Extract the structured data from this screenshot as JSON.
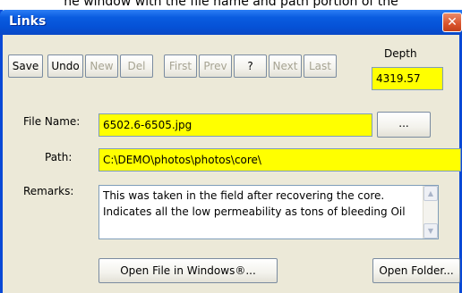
{
  "caption": "he window with the file name and path portion of the",
  "window": {
    "title": "Links",
    "close_label": "✕"
  },
  "toolbar": {
    "save_label": "Save",
    "undo_label": "Undo",
    "new_label": "New",
    "del_label": "Del",
    "first_label": "First",
    "prev_label": "Prev",
    "help_label": "?",
    "next_label": "Next",
    "last_label": "Last"
  },
  "depth": {
    "label": "Depth",
    "value": "4319.57"
  },
  "form": {
    "file_name_label": "File Name:",
    "file_name_value": "6502.6-6505.jpg",
    "browse_label": "...",
    "path_label": "Path:",
    "path_value": "C:\\DEMO\\photos\\photos\\core\\",
    "remarks_label": "Remarks:",
    "remarks_value": "This was taken in the field after recovering the core.\nIndicates all the low permeability as tons of bleeding Oil"
  },
  "actions": {
    "open_file_label": "Open File in Windows®...",
    "open_folder_label": "Open Folder..."
  },
  "icons": {
    "close": "close-icon",
    "scroll_up": "scroll-up-arrow-icon",
    "scroll_down": "scroll-down-arrow-icon"
  },
  "colors": {
    "title_bar": "#0a5ce0",
    "field_highlight": "#ffff00",
    "close_button": "#d9532c",
    "window_face": "#ece9d8"
  }
}
